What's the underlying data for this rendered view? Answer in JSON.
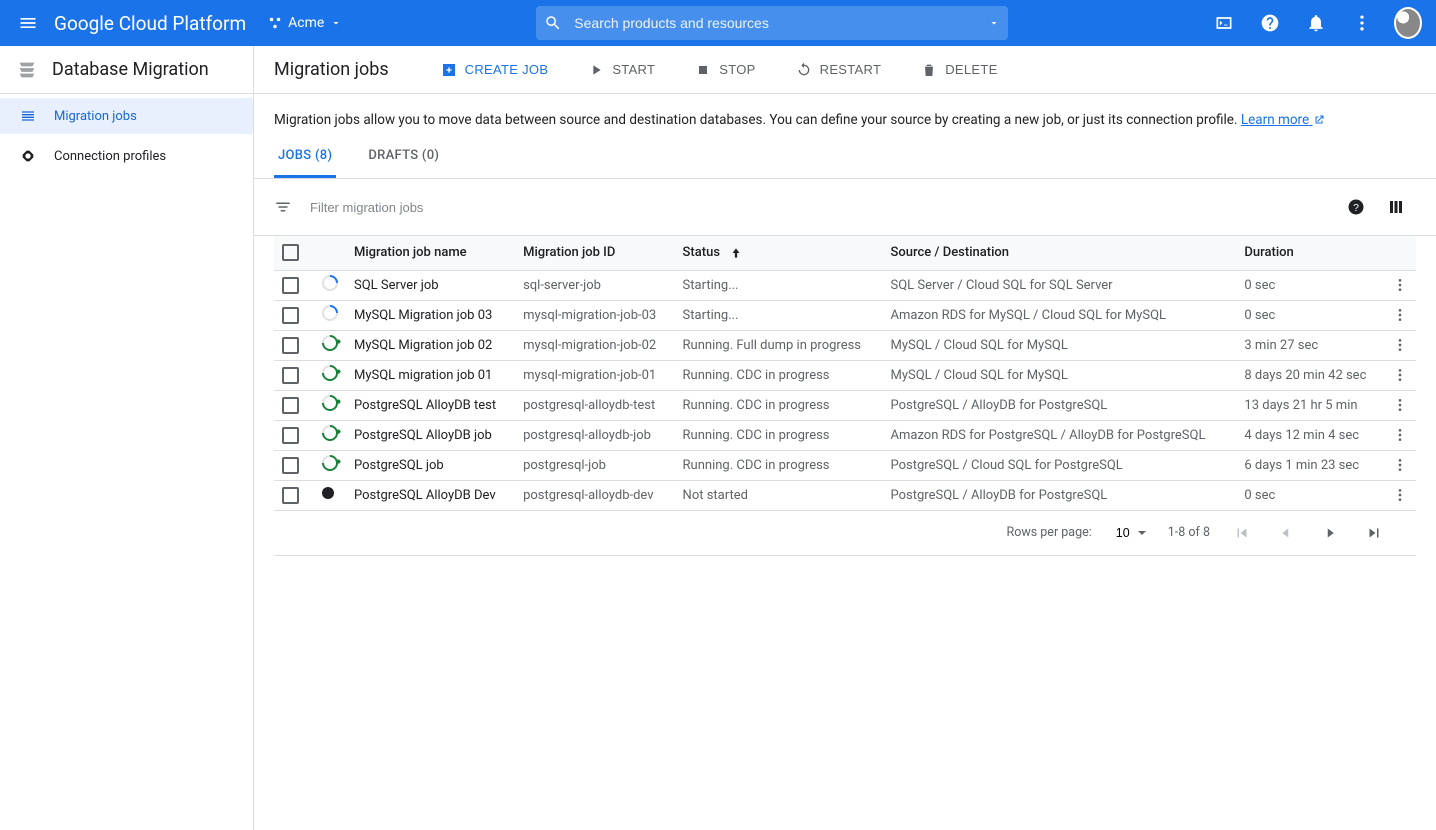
{
  "header": {
    "platform": "Google Cloud Platform",
    "project": "Acme",
    "search_placeholder": "Search products and resources"
  },
  "sidebar": {
    "title": "Database Migration",
    "items": [
      {
        "label": "Migration jobs",
        "active": true
      },
      {
        "label": "Connection profiles",
        "active": false
      }
    ]
  },
  "page": {
    "title": "Migration jobs",
    "intro": "Migration jobs allow you to move data between source and destination databases. You can define your source by creating a new job, or just its connection profile. ",
    "learn_more": "Learn more"
  },
  "actions": {
    "create": "CREATE JOB",
    "start": "START",
    "stop": "STOP",
    "restart": "RESTART",
    "delete": "DELETE"
  },
  "tabs": [
    {
      "label": "JOBS (8)",
      "active": true
    },
    {
      "label": "DRAFTS (0)",
      "active": false
    }
  ],
  "filter": {
    "placeholder": "Filter migration jobs"
  },
  "columns": {
    "name": "Migration job name",
    "id": "Migration job ID",
    "status": "Status",
    "source_dest": "Source / Destination",
    "duration": "Duration"
  },
  "rows": [
    {
      "status_icon": "starting",
      "name": "SQL Server job",
      "id": "sql-server-job",
      "status": "Starting...",
      "source_dest": "SQL Server / Cloud SQL for SQL Server",
      "duration": "0 sec"
    },
    {
      "status_icon": "starting",
      "name": "MySQL Migration job 03",
      "id": "mysql-migration-job-03",
      "status": "Starting...",
      "source_dest": "Amazon RDS for MySQL / Cloud SQL for MySQL",
      "duration": "0 sec"
    },
    {
      "status_icon": "running",
      "name": "MySQL Migration job 02",
      "id": "mysql-migration-job-02",
      "status": "Running. Full dump in progress",
      "source_dest": "MySQL / Cloud SQL for MySQL",
      "duration": "3 min 27 sec"
    },
    {
      "status_icon": "running",
      "name": "MySQL migration job 01",
      "id": "mysql-migration-job-01",
      "status": "Running. CDC in progress",
      "source_dest": "MySQL / Cloud SQL for MySQL",
      "duration": "8 days 20 min 42 sec"
    },
    {
      "status_icon": "running",
      "name": "PostgreSQL AlloyDB test",
      "id": "postgresql-alloydb-test",
      "status": "Running. CDC in progress",
      "source_dest": "PostgreSQL / AlloyDB for PostgreSQL",
      "duration": "13 days 21 hr 5 min"
    },
    {
      "status_icon": "running",
      "name": "PostgreSQL AlloyDB job",
      "id": "postgresql-alloydb-job",
      "status": "Running. CDC in progress",
      "source_dest": "Amazon RDS for PostgreSQL / AlloyDB for PostgreSQL",
      "duration": "4 days 12 min 4 sec"
    },
    {
      "status_icon": "running",
      "name": "PostgreSQL job",
      "id": "postgresql-job",
      "status": "Running. CDC in progress",
      "source_dest": "PostgreSQL / Cloud SQL for PostgreSQL",
      "duration": "6 days 1 min 23 sec"
    },
    {
      "status_icon": "not_started",
      "name": "PostgreSQL AlloyDB Dev",
      "id": "postgresql-alloydb-dev",
      "status": "Not started",
      "source_dest": "PostgreSQL / AlloyDB for PostgreSQL",
      "duration": "0 sec"
    }
  ],
  "pagination": {
    "rows_label": "Rows per page:",
    "rows_value": "10",
    "range": "1-8 of 8"
  }
}
